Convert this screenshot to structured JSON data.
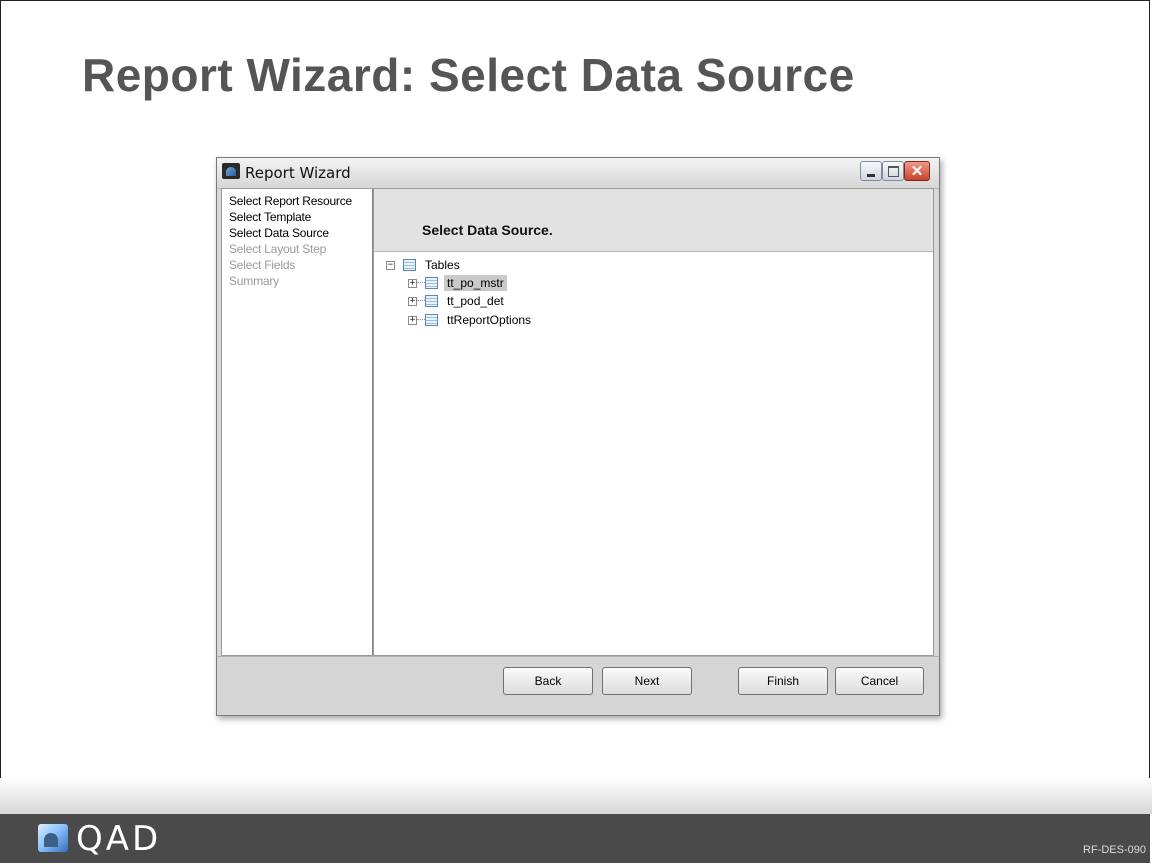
{
  "slide": {
    "title": "Report Wizard: Select Data Source",
    "code": "RF-DES-090",
    "brand": "QAD"
  },
  "window": {
    "title": "Report Wizard",
    "controls": {
      "minimize": "minimize-icon",
      "maximize": "maximize-icon",
      "close": "close-icon"
    }
  },
  "steps": [
    {
      "label": "Select Report Resource",
      "enabled": true
    },
    {
      "label": "Select Template",
      "enabled": true
    },
    {
      "label": "Select Data Source",
      "enabled": true
    },
    {
      "label": "Select Layout Step",
      "enabled": false
    },
    {
      "label": "Select Fields",
      "enabled": false
    },
    {
      "label": "Summary",
      "enabled": false
    }
  ],
  "content": {
    "header": "Select Data Source."
  },
  "tree": {
    "root": {
      "label": "Tables",
      "expanded": true
    },
    "children": [
      {
        "label": "tt_po_mstr",
        "selected": true
      },
      {
        "label": "tt_pod_det",
        "selected": false
      },
      {
        "label": "ttReportOptions",
        "selected": false
      }
    ]
  },
  "buttons": {
    "back": "Back",
    "next": "Next",
    "finish": "Finish",
    "cancel": "Cancel"
  },
  "colors": {
    "title_gray": "#555555",
    "selection": "#c9c9c9",
    "footer_bar": "#4a4a4a"
  }
}
